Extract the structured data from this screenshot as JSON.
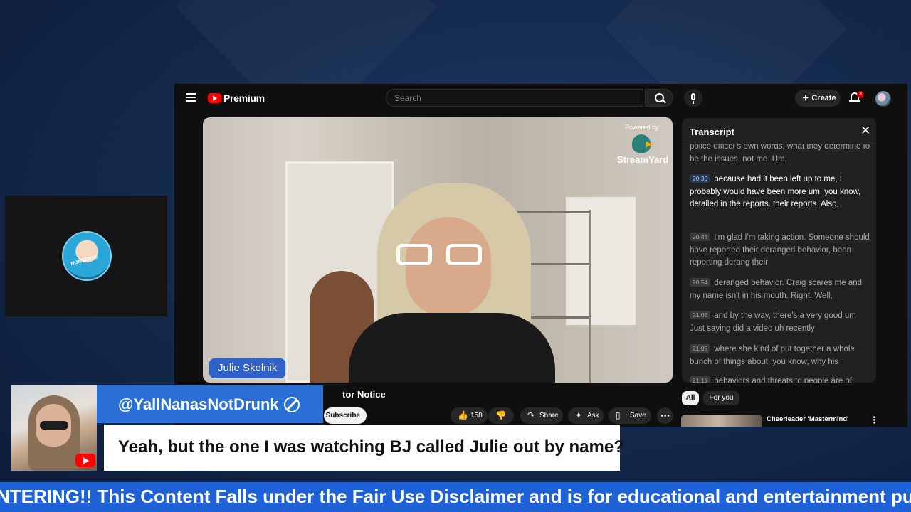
{
  "youtube": {
    "brand": "Premium",
    "search_placeholder": "Search",
    "create_label": "Create",
    "notification_count": "3",
    "video": {
      "overlay_name": "Julie Skolnik",
      "powered_by": "Powered by",
      "streamyard": "StreamYard",
      "title_partial": "tor Notice"
    },
    "actions": {
      "subscribe": "Subscribe",
      "likes": "158",
      "share": "Share",
      "ask": "Ask",
      "save": "Save",
      "more": "⋯"
    },
    "transcript": {
      "title": "Transcript",
      "segments": [
        {
          "time": "",
          "text": "police officer's own words, what they determine to be the issues, not me. Um,",
          "active": false
        },
        {
          "time": "20:36",
          "text": "because had it been left up to me, I probably would have been more um, you know, detailed in the reports. their reports. Also,",
          "active": true
        },
        {
          "time": "20:48",
          "text": "I'm glad I'm taking action. Someone should have reported their deranged behavior, been reporting derang their",
          "active": false
        },
        {
          "time": "20:54",
          "text": "deranged behavior. Craig scares me and my name isn't in his mouth. Right. Well,",
          "active": false
        },
        {
          "time": "21:02",
          "text": "and by the way, there's a very good um Just saying did a video uh recently",
          "active": false
        },
        {
          "time": "21:09",
          "text": "where she kind of put together a whole bunch of things about, you know, why his",
          "active": false
        },
        {
          "time": "21:15",
          "text": "behaviors and threats to people are of",
          "active": false
        }
      ]
    },
    "chips": {
      "all": "All",
      "for_you": "For you"
    },
    "recommended": {
      "title": "Cheerleader 'Mastermind'"
    }
  },
  "chat": {
    "username": "@YallNanasNotDrunk",
    "message": "Yeah, but the one I was watching BJ called Julie out by name?"
  },
  "ticker": {
    "text": "NTERING!! This Content Falls under the Fair Use Disclaimer and is for educational and entertainment purposes"
  },
  "left_logo": {
    "text": "NONSENSE"
  },
  "colors": {
    "background": "#13284a",
    "accent_blue": "#2a6fd6",
    "ticker_blue": "#1f61d6",
    "youtube_red": "#ff0000",
    "name_tag": "#2f62c8"
  }
}
